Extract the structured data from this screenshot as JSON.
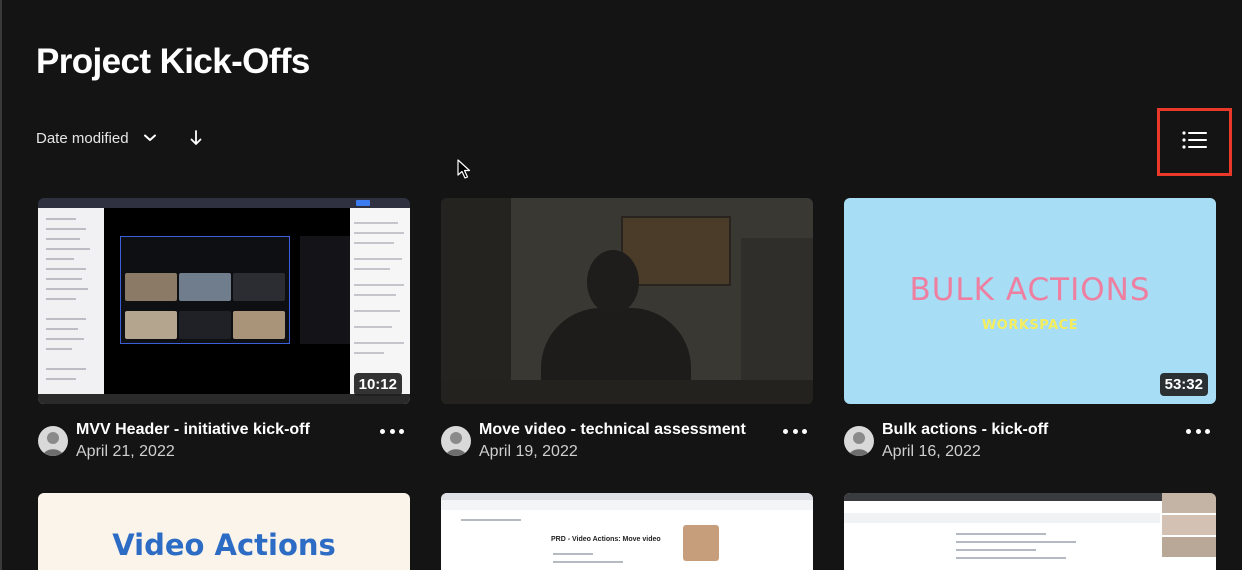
{
  "page": {
    "title": "Project Kick-Offs"
  },
  "sort": {
    "label": "Date modified",
    "chevron_icon": "chevron-down-icon",
    "direction_icon": "arrow-down-icon"
  },
  "view_toggle": {
    "icon": "list-view-icon",
    "highlight_color": "#e8392a"
  },
  "videos": [
    {
      "title": "MVV Header - initiative kick-off",
      "date": "April 21, 2022",
      "duration": "10:12"
    },
    {
      "title": "Move video - technical assessment",
      "date": "April 19, 2022",
      "duration": ""
    },
    {
      "title": "Bulk actions - kick-off",
      "date": "April 16, 2022",
      "duration": "53:32",
      "thumb_text": "BULK ACTIONS",
      "thumb_subtext": "WORKSPACE"
    },
    {
      "thumb_text": "Video Actions"
    },
    {
      "thumb_text": "PRD - Video Actions: Move video"
    },
    {
      "thumb_text": ""
    }
  ],
  "colors": {
    "background": "#141414",
    "bulk_bg": "#a7ddf5",
    "bulk_text": "#ee7fa0",
    "bulk_subtext": "#f4ee5f",
    "video_actions_text": "#2c6cc5"
  }
}
